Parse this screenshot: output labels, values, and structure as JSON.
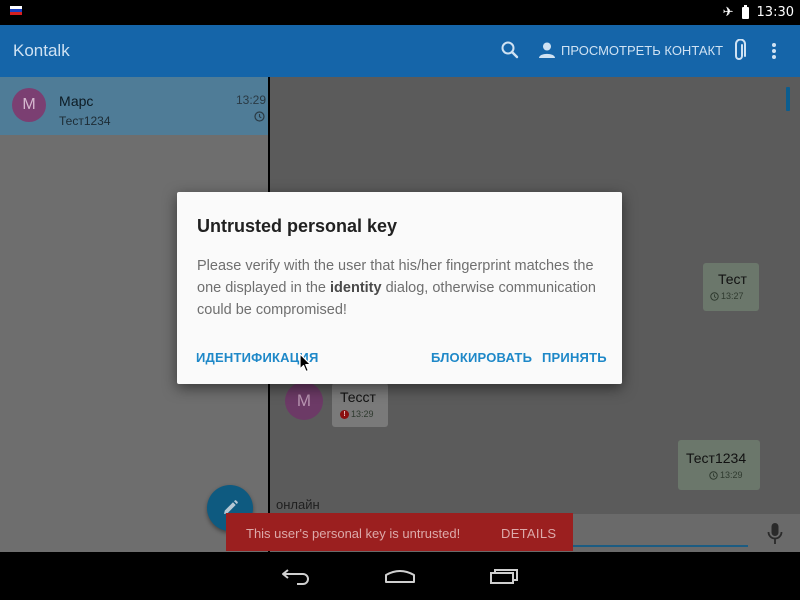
{
  "status_bar": {
    "time": "13:30",
    "flag_colors": [
      "#ffffff",
      "#1a3fc0",
      "#d51f1f"
    ]
  },
  "toolbar": {
    "app_title": "Kontalk",
    "view_contact_label": "ПРОСМОТРЕТЬ КОНТАКТ",
    "icons": [
      "search-icon",
      "person-icon",
      "attach-icon",
      "more-vert-icon"
    ],
    "color": "#1565a9"
  },
  "conversation_list": {
    "items": [
      {
        "avatar_letter": "M",
        "name": "Марс",
        "preview": "Тест1234",
        "time": "13:29",
        "status_icon": "clock-icon"
      }
    ]
  },
  "chat": {
    "messages": [
      {
        "direction": "out",
        "text": "Тест",
        "time": "13:27",
        "status_icon": "clock-icon"
      },
      {
        "direction": "in",
        "avatar_letter": "M",
        "text": "Тесст",
        "time": "13:29",
        "status_icon": "error-icon"
      },
      {
        "direction": "out",
        "text": "Тест1234",
        "time": "13:29",
        "status_icon": "clock-icon"
      }
    ],
    "contact_status": "онлайн"
  },
  "snackbar": {
    "text": "This user's personal key is untrusted!",
    "action": "DETAILS",
    "color": "#9b1f1f"
  },
  "dialog": {
    "title": "Untrusted personal key",
    "body_before": "Please verify with the user that his/her fingerprint matches the one displayed in the ",
    "body_bold": "identity",
    "body_after": " dialog, otherwise communication could be compromised!",
    "buttons": {
      "identification": "ИДЕНТИФИКАЦИЯ",
      "block": "БЛОКИРОВАТЬ",
      "accept": "ПРИНЯТЬ"
    },
    "accent": "#1e88c8"
  }
}
